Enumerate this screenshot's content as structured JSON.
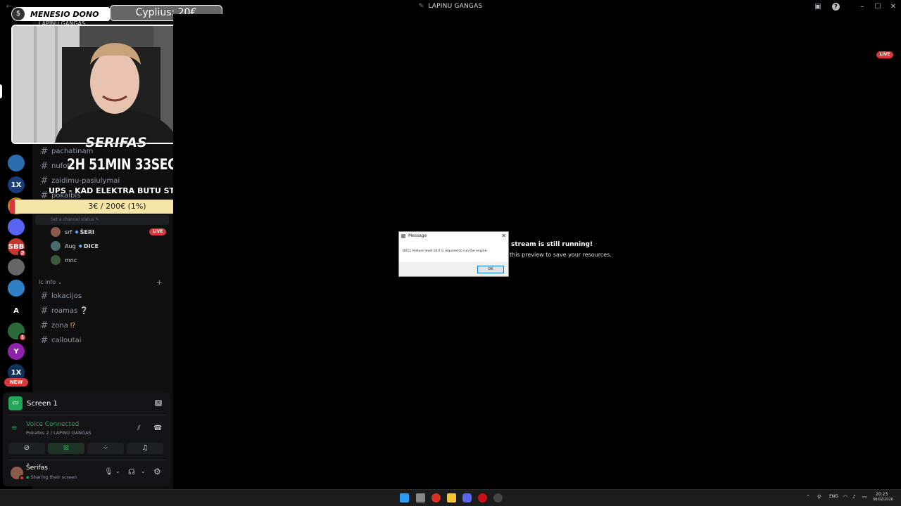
{
  "window": {
    "title": "LAPINU GANGAS"
  },
  "servers": [
    {
      "icon": "atom-server-icon",
      "color": "#2b6cb0"
    },
    {
      "icon": "1x-server-icon",
      "label": "1X",
      "color": "#1a3d7a"
    },
    {
      "icon": "yellow-server-icon",
      "color": "#b8860b"
    },
    {
      "icon": "folder-server-icon",
      "color": "#5865f2"
    },
    {
      "icon": "sbb-server-icon",
      "label": "SBB",
      "color": "#c0392b",
      "badge": "2"
    },
    {
      "icon": "anime-server-icon",
      "color": "#666"
    },
    {
      "icon": "blue-server-icon",
      "color": "#2f80c4"
    },
    {
      "icon": "a-server-icon",
      "label": "A",
      "color": "#000"
    },
    {
      "icon": "green-server-icon",
      "color": "#2d6a3a",
      "badge": "1"
    },
    {
      "icon": "purple-server-icon",
      "label": "Y",
      "color": "#8e24aa"
    },
    {
      "icon": "1xpin-server-icon",
      "label": "1X",
      "color": "#10335e"
    }
  ],
  "rail_new_badge": "NEW",
  "overlay": {
    "donation_label": "MENESIO DONO",
    "donation_amount": "Cyplius: 20€",
    "overlay_server_name": "LAPINU GANGAS",
    "streamer_name": "SERIFAS",
    "timer": "2H 51MIN 33SEC",
    "goal_title": "UPS - KAD ELEKTRA BUTU STABILI",
    "goal_progress_text": "3€ / 200€ (1%)",
    "goal_progress": 0.01
  },
  "channels_top": [
    {
      "name": "pachatinam"
    },
    {
      "name": "nufotk"
    },
    {
      "name": "zaidimu-pasiulymai"
    },
    {
      "name": "pokalbis"
    }
  ],
  "channel_status_hint": "Set a channel status",
  "voice_users": [
    {
      "name": "srf",
      "role": "ŠERI",
      "live": "LIVE",
      "avatar": "#8a5a4a"
    },
    {
      "name": "Aug",
      "role": "DICE",
      "avatar": "#4a6a6a"
    },
    {
      "name": "mnc",
      "avatar": "#3a5a3a"
    }
  ],
  "category": {
    "name": "lc info"
  },
  "channels_info": [
    {
      "name": "lokacijos",
      "emoji": ""
    },
    {
      "name": "roamas",
      "emoji": "❔"
    },
    {
      "name": "zona",
      "emoji": "⁉"
    },
    {
      "name": "calloutai",
      "emoji": ""
    }
  ],
  "panel": {
    "screen_label": "Screen 1",
    "voice_status": "Voice Connected",
    "voice_channel": "Pokalbis 2 / LAPINU GANGAS",
    "user_name": "Šerifas",
    "user_status": "Sharing their screen"
  },
  "main": {
    "live_badge": "LIVE",
    "stream_msg_title": "stream is still running!",
    "stream_msg_sub": "this preview to save your resources."
  },
  "dialog": {
    "title": "Message",
    "message": "DX11 feature level 10.0 is required to run the engine.",
    "ok_label": "OK"
  },
  "taskbar": {
    "lang": "ENG",
    "time": "20:23",
    "date": "08/02/2026"
  },
  "colors": {
    "accent": "#5865f2",
    "live": "#da373c",
    "green": "#23a55a",
    "gold_goal": "#f5e6a8"
  }
}
